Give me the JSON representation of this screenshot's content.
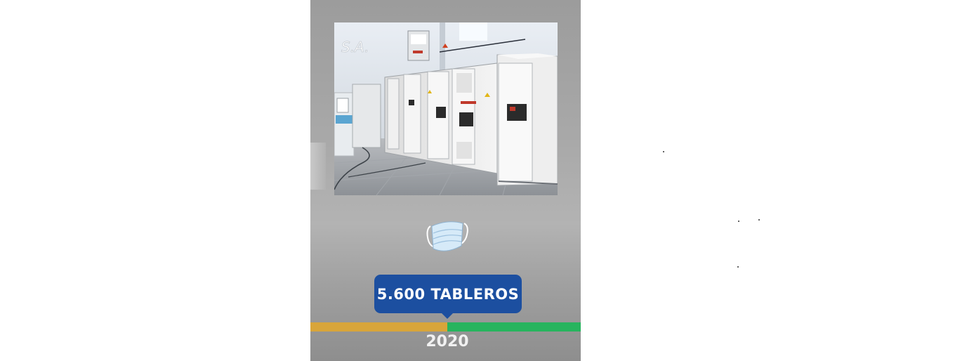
{
  "slide": {
    "badge_text": "5.600 TABLEROS",
    "year": "2020",
    "photo_sign_text": "S.A.",
    "mask_icon": "face-mask-icon"
  },
  "colors": {
    "badge_blue": "#1c4fa0",
    "timeline_past": "#d8a53a",
    "timeline_current": "#27b45e",
    "panel_gray": "#a9a9a9"
  }
}
